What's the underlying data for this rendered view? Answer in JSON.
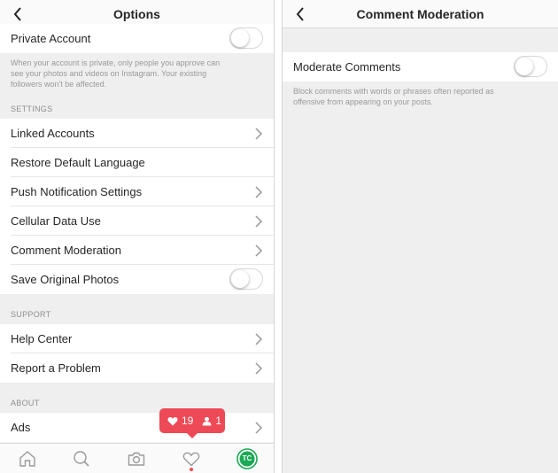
{
  "left": {
    "title": "Options",
    "private_account": {
      "label": "Private Account",
      "enabled": false,
      "help_lines": [
        "When your account is private, only people you approve can",
        "see your photos and videos on Instagram. Your existing",
        "followers won't be affected."
      ]
    },
    "settings_header": "SETTINGS",
    "settings_items": [
      {
        "label": "Linked Accounts"
      },
      {
        "label": "Restore Default Language"
      },
      {
        "label": "Push Notification Settings"
      },
      {
        "label": "Cellular Data Use"
      },
      {
        "label": "Comment Moderation"
      },
      {
        "label": "Save Original Photos"
      }
    ],
    "support_header": "SUPPORT",
    "support_items": [
      {
        "label": "Help Center"
      },
      {
        "label": "Report a Problem"
      }
    ],
    "about_header": "ABOUT",
    "about_items": [
      {
        "label": "Ads"
      }
    ],
    "notification": {
      "likes": "19",
      "followers": "1"
    },
    "tabbar": {
      "icons": [
        "home-icon",
        "search-icon",
        "camera-icon",
        "heart-icon",
        "profile-avatar-icon"
      ],
      "avatar_text": "TC"
    }
  },
  "right": {
    "title": "Comment Moderation",
    "moderate_comments": {
      "label": "Moderate Comments",
      "enabled": false
    },
    "help_lines": [
      "Block comments with words or phrases often reported as",
      "offensive from appearing on your posts."
    ]
  },
  "colors": {
    "accent_red": "#ed4956",
    "avatar_green": "#1aaa55",
    "background": "#efefef",
    "secondary_text": "#999999"
  }
}
